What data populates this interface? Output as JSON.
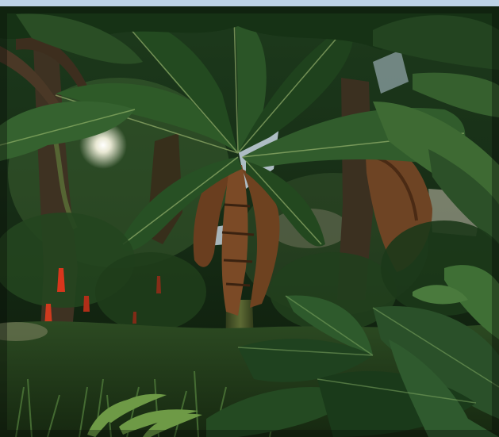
{
  "window": {
    "title_bar_color": "#bcd3e6"
  },
  "scene": {
    "type": "3d-game-viewport",
    "environment": "tropical-jungle",
    "palette": {
      "sky": "#c9d6e3",
      "canopy_dark": "#0c1f10",
      "leaf_mid": "#2f5a2a",
      "leaf_light": "#6f9a4f",
      "trunk_brown": "#5a3a1e",
      "dead_leaf": "#7a4a26",
      "sun_glow": "#fffbe8",
      "flower_red": "#d8361c",
      "ground": "#243a1c"
    }
  }
}
